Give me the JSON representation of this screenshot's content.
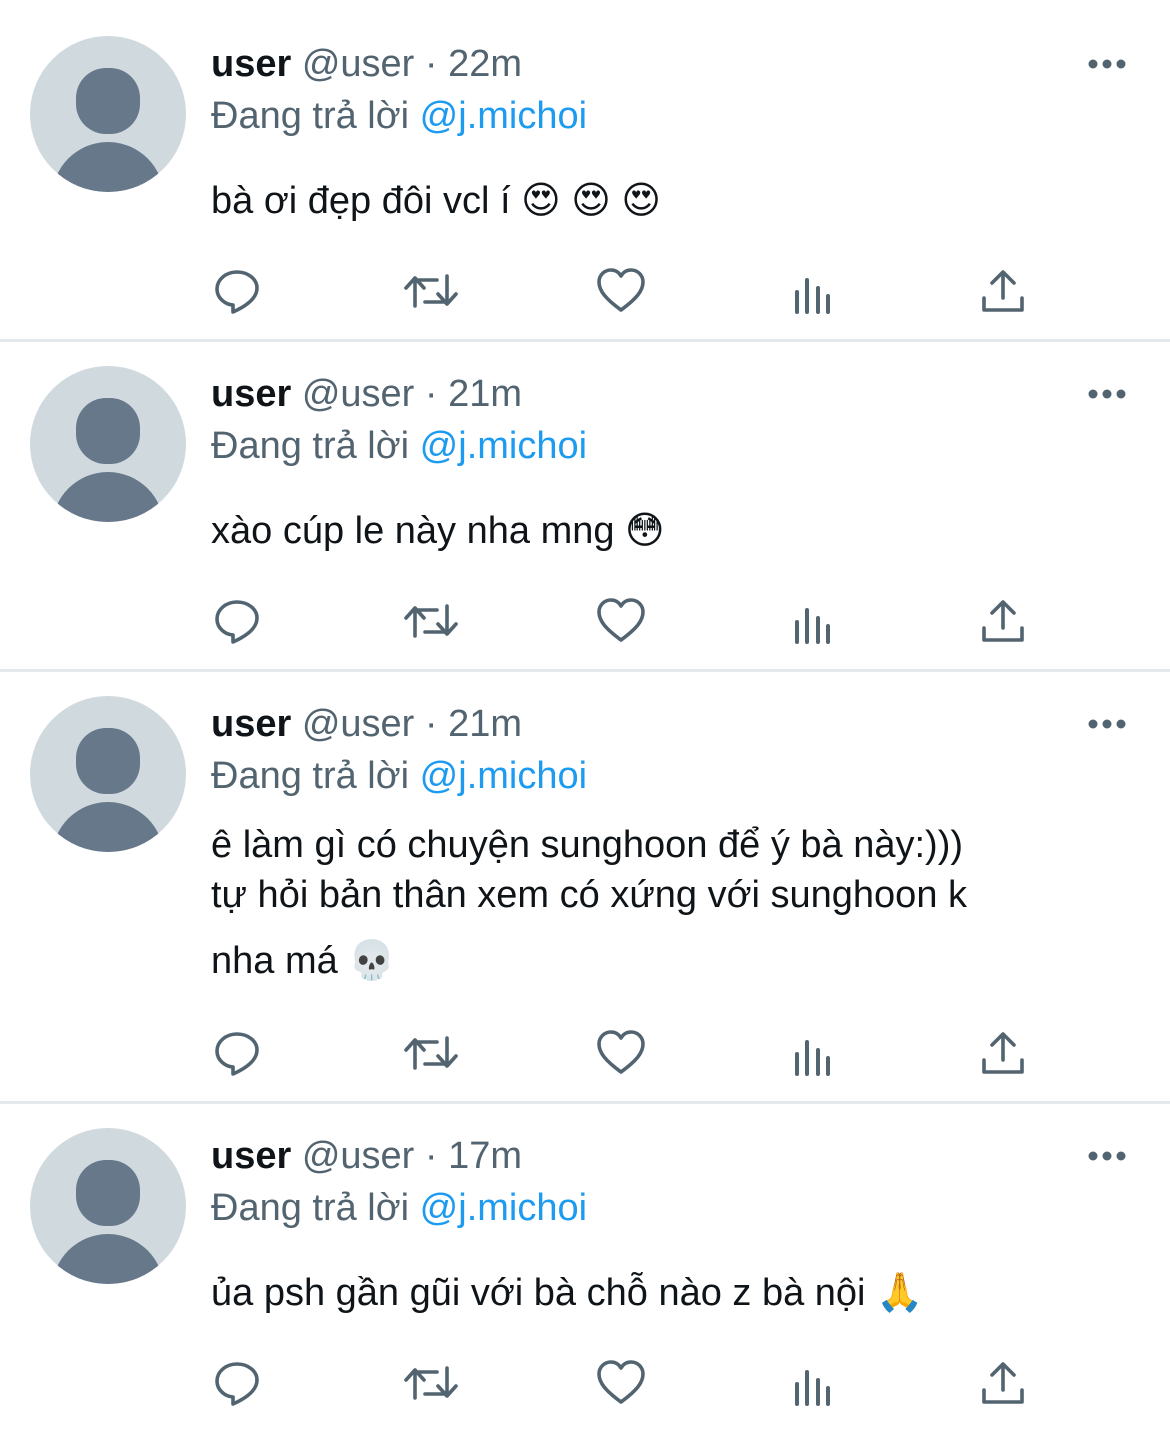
{
  "tweets": [
    {
      "name": "user",
      "handle": "@user",
      "separator": "·",
      "time": "22m",
      "reply_prefix": "Đang trả lời",
      "reply_to": "@j.michoi",
      "lines": [
        "bà ơi đẹp đôi vcl í 😍 😍 😍"
      ]
    },
    {
      "name": "user",
      "handle": "@user",
      "separator": "·",
      "time": "21m",
      "reply_prefix": "Đang trả lời",
      "reply_to": "@j.michoi",
      "lines": [
        "xào cúp le này nha mng 😳"
      ]
    },
    {
      "name": "user",
      "handle": "@user",
      "separator": "·",
      "time": "21m",
      "reply_prefix": "Đang trả lời",
      "reply_to": "@j.michoi",
      "lines": [
        "ê làm gì có chuyện sunghoon để ý bà này:)))",
        "tự hỏi bản thân xem có xứng với sunghoon k",
        "nha má 💀"
      ]
    },
    {
      "name": "user",
      "handle": "@user",
      "separator": "·",
      "time": "17m",
      "reply_prefix": "Đang trả lời",
      "reply_to": "@j.michoi",
      "lines": [
        "ủa psh gần gũi với bà chỗ nào z bà nội 🙏"
      ]
    }
  ],
  "icons": {
    "more": "more-horizontal-icon",
    "reply": "reply-icon",
    "retweet": "retweet-icon",
    "like": "heart-icon",
    "views": "views-bar-chart-icon",
    "share": "share-icon"
  },
  "colors": {
    "text": "#0f1419",
    "secondary": "#536471",
    "mention": "#1d9bf0",
    "avatar_bg": "#cfd9de",
    "avatar_fg": "#67788a",
    "divider": "#e6e9ec"
  }
}
